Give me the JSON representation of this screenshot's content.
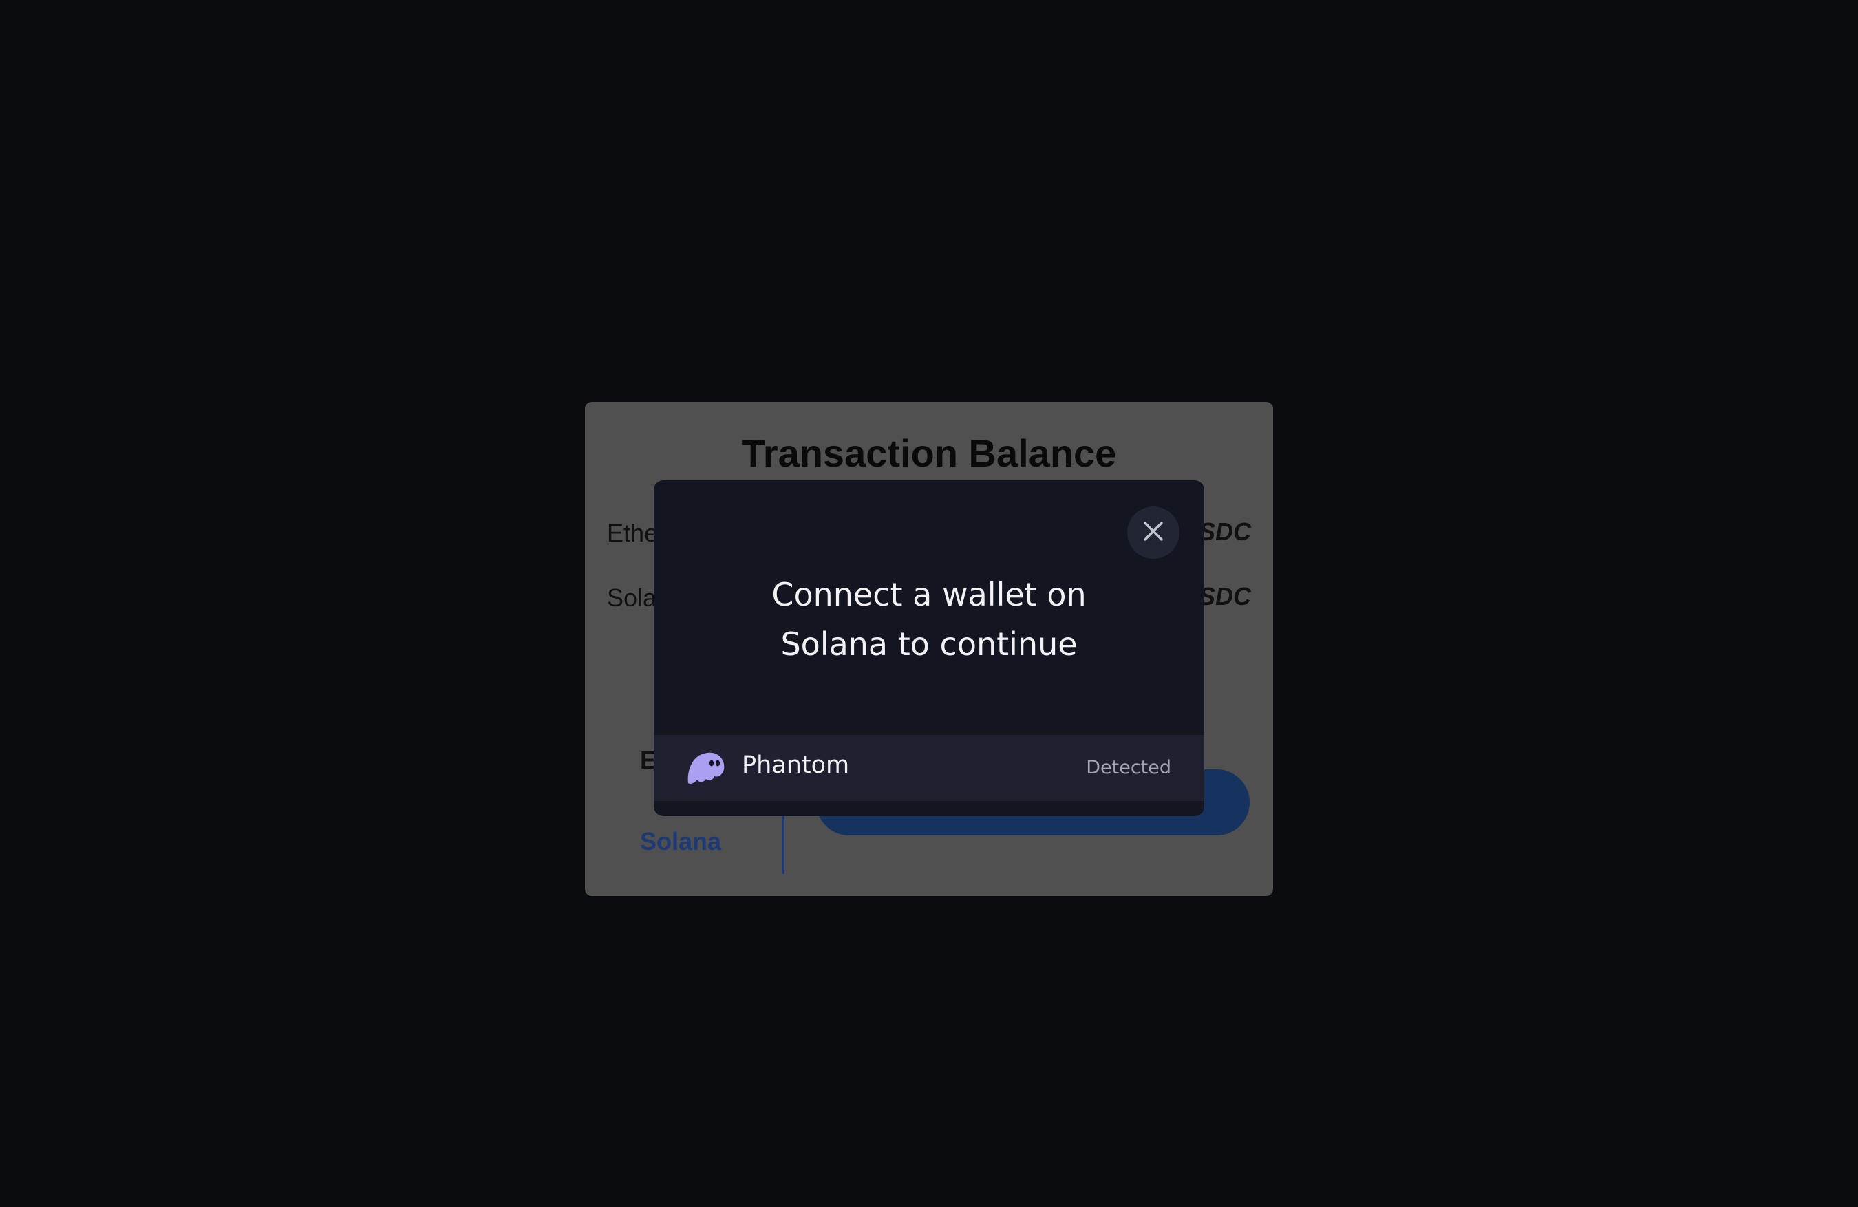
{
  "background_card": {
    "title": "Transaction Balance",
    "rows": [
      {
        "label": "Ethe",
        "value": "SDC"
      },
      {
        "label": "Sola",
        "value": "SDC"
      }
    ],
    "tabs": {
      "ethereum_partial": "E",
      "solana": "Solana"
    }
  },
  "modal": {
    "title": "Connect a wallet on\nSolana to continue",
    "close_icon": "close-icon",
    "wallets": [
      {
        "name": "Phantom",
        "status": "Detected",
        "icon": "phantom-ghost-icon"
      }
    ]
  },
  "colors": {
    "page_background": "#0b0c0f",
    "modal_background": "#131521",
    "wallet_row_background": "#1f2131",
    "phantom_accent": "#ab9ff2",
    "solana_tab": "#1d3a75"
  }
}
